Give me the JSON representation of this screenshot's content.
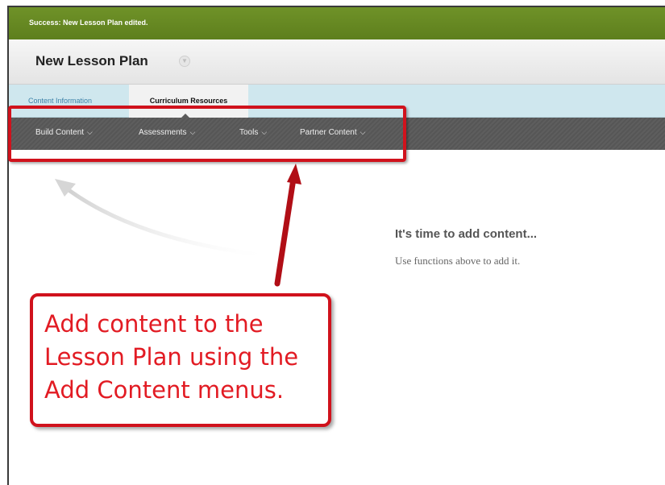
{
  "success_message": "Success: New Lesson Plan edited.",
  "page_title": "New Lesson Plan",
  "tabs": [
    {
      "label": "Content Information",
      "active": false
    },
    {
      "label": "Curriculum Resources",
      "active": true
    }
  ],
  "menu": [
    {
      "label": "Build Content",
      "icon": "chevron-down-icon"
    },
    {
      "label": "Assessments",
      "icon": "chevron-down-icon"
    },
    {
      "label": "Tools",
      "icon": "chevron-down-icon"
    },
    {
      "label": "Partner Content",
      "icon": "chevron-down-icon"
    }
  ],
  "empty_state": {
    "title": "It's time to add content...",
    "subtitle": "Use functions above to add it."
  },
  "annotation": {
    "lines": [
      "Add content to the",
      "Lesson Plan using the",
      "Add Content menus."
    ],
    "color": "#e21b23"
  },
  "colors": {
    "success_green": "#6b8e23",
    "menu_gray": "#595959",
    "tab_blue": "#cfe7ee",
    "annotation_red": "#d0121c"
  }
}
